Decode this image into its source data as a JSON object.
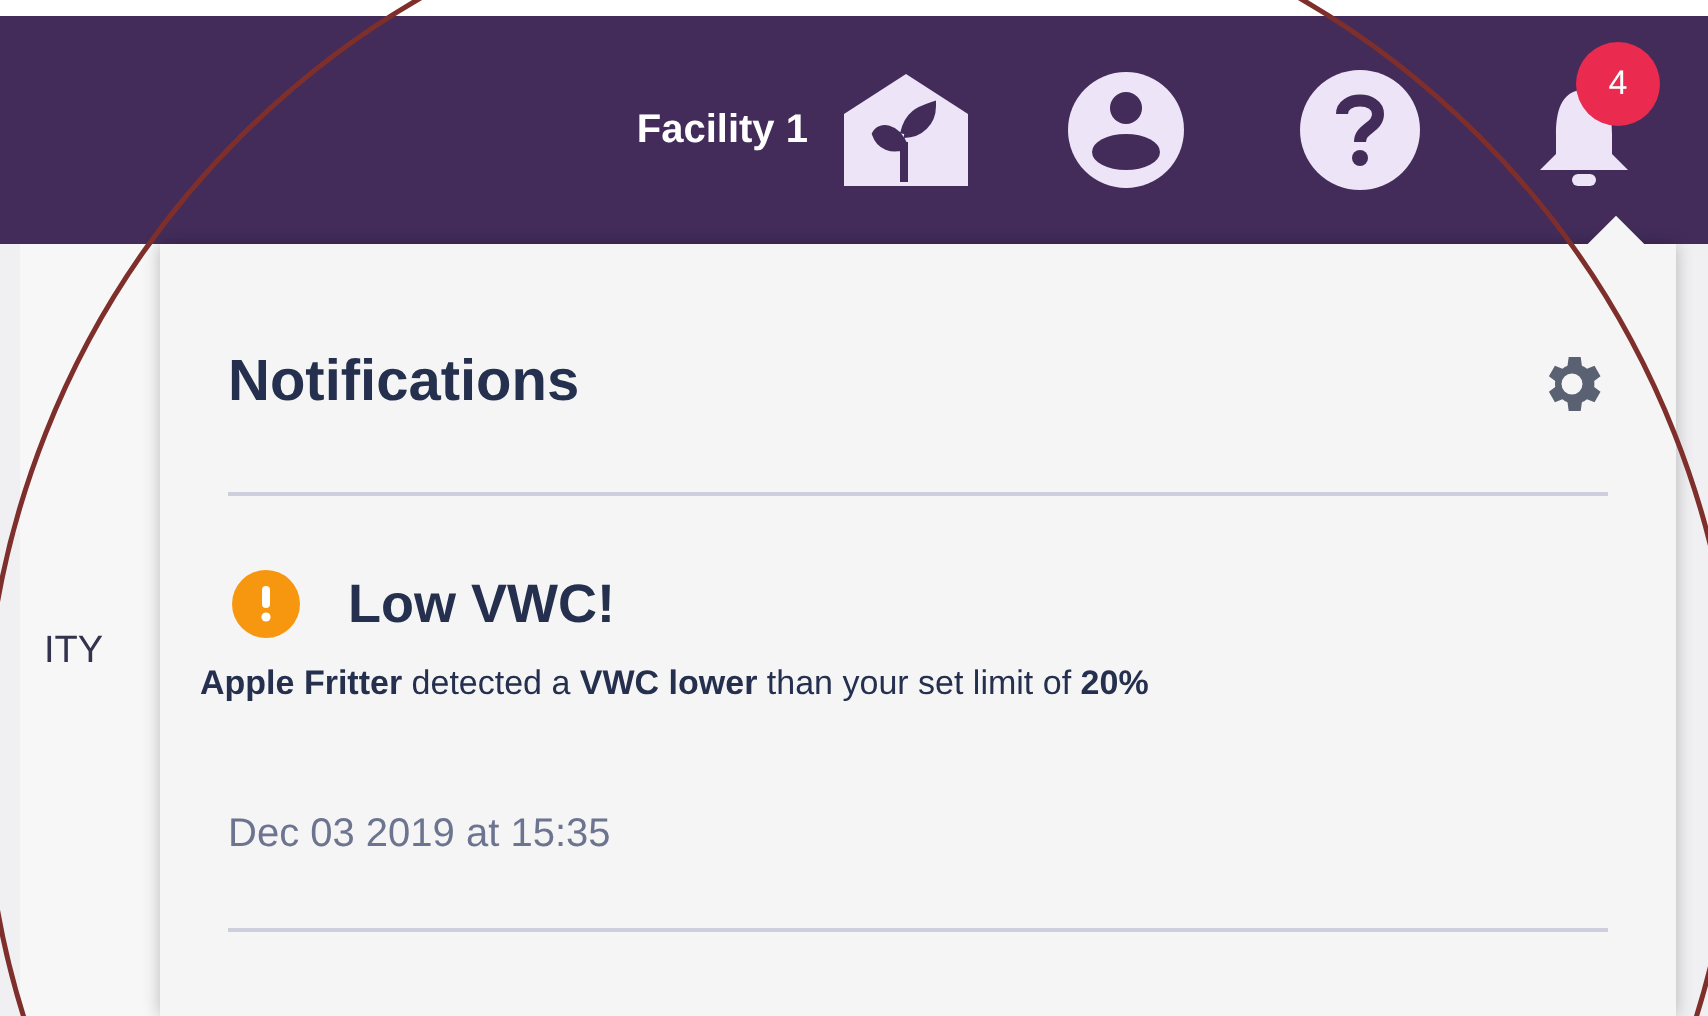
{
  "header": {
    "facility": "Facility 1",
    "badge": "4"
  },
  "background": {
    "column_heading": "ITY"
  },
  "notifications_panel": {
    "title": "Notifications",
    "items": [
      {
        "title": "Low VWC!",
        "message": "**Apple Fritter** detected a **VWC lower** than your set limit of **20%**",
        "time": "Dec 03 2019 at 15:35"
      }
    ]
  }
}
